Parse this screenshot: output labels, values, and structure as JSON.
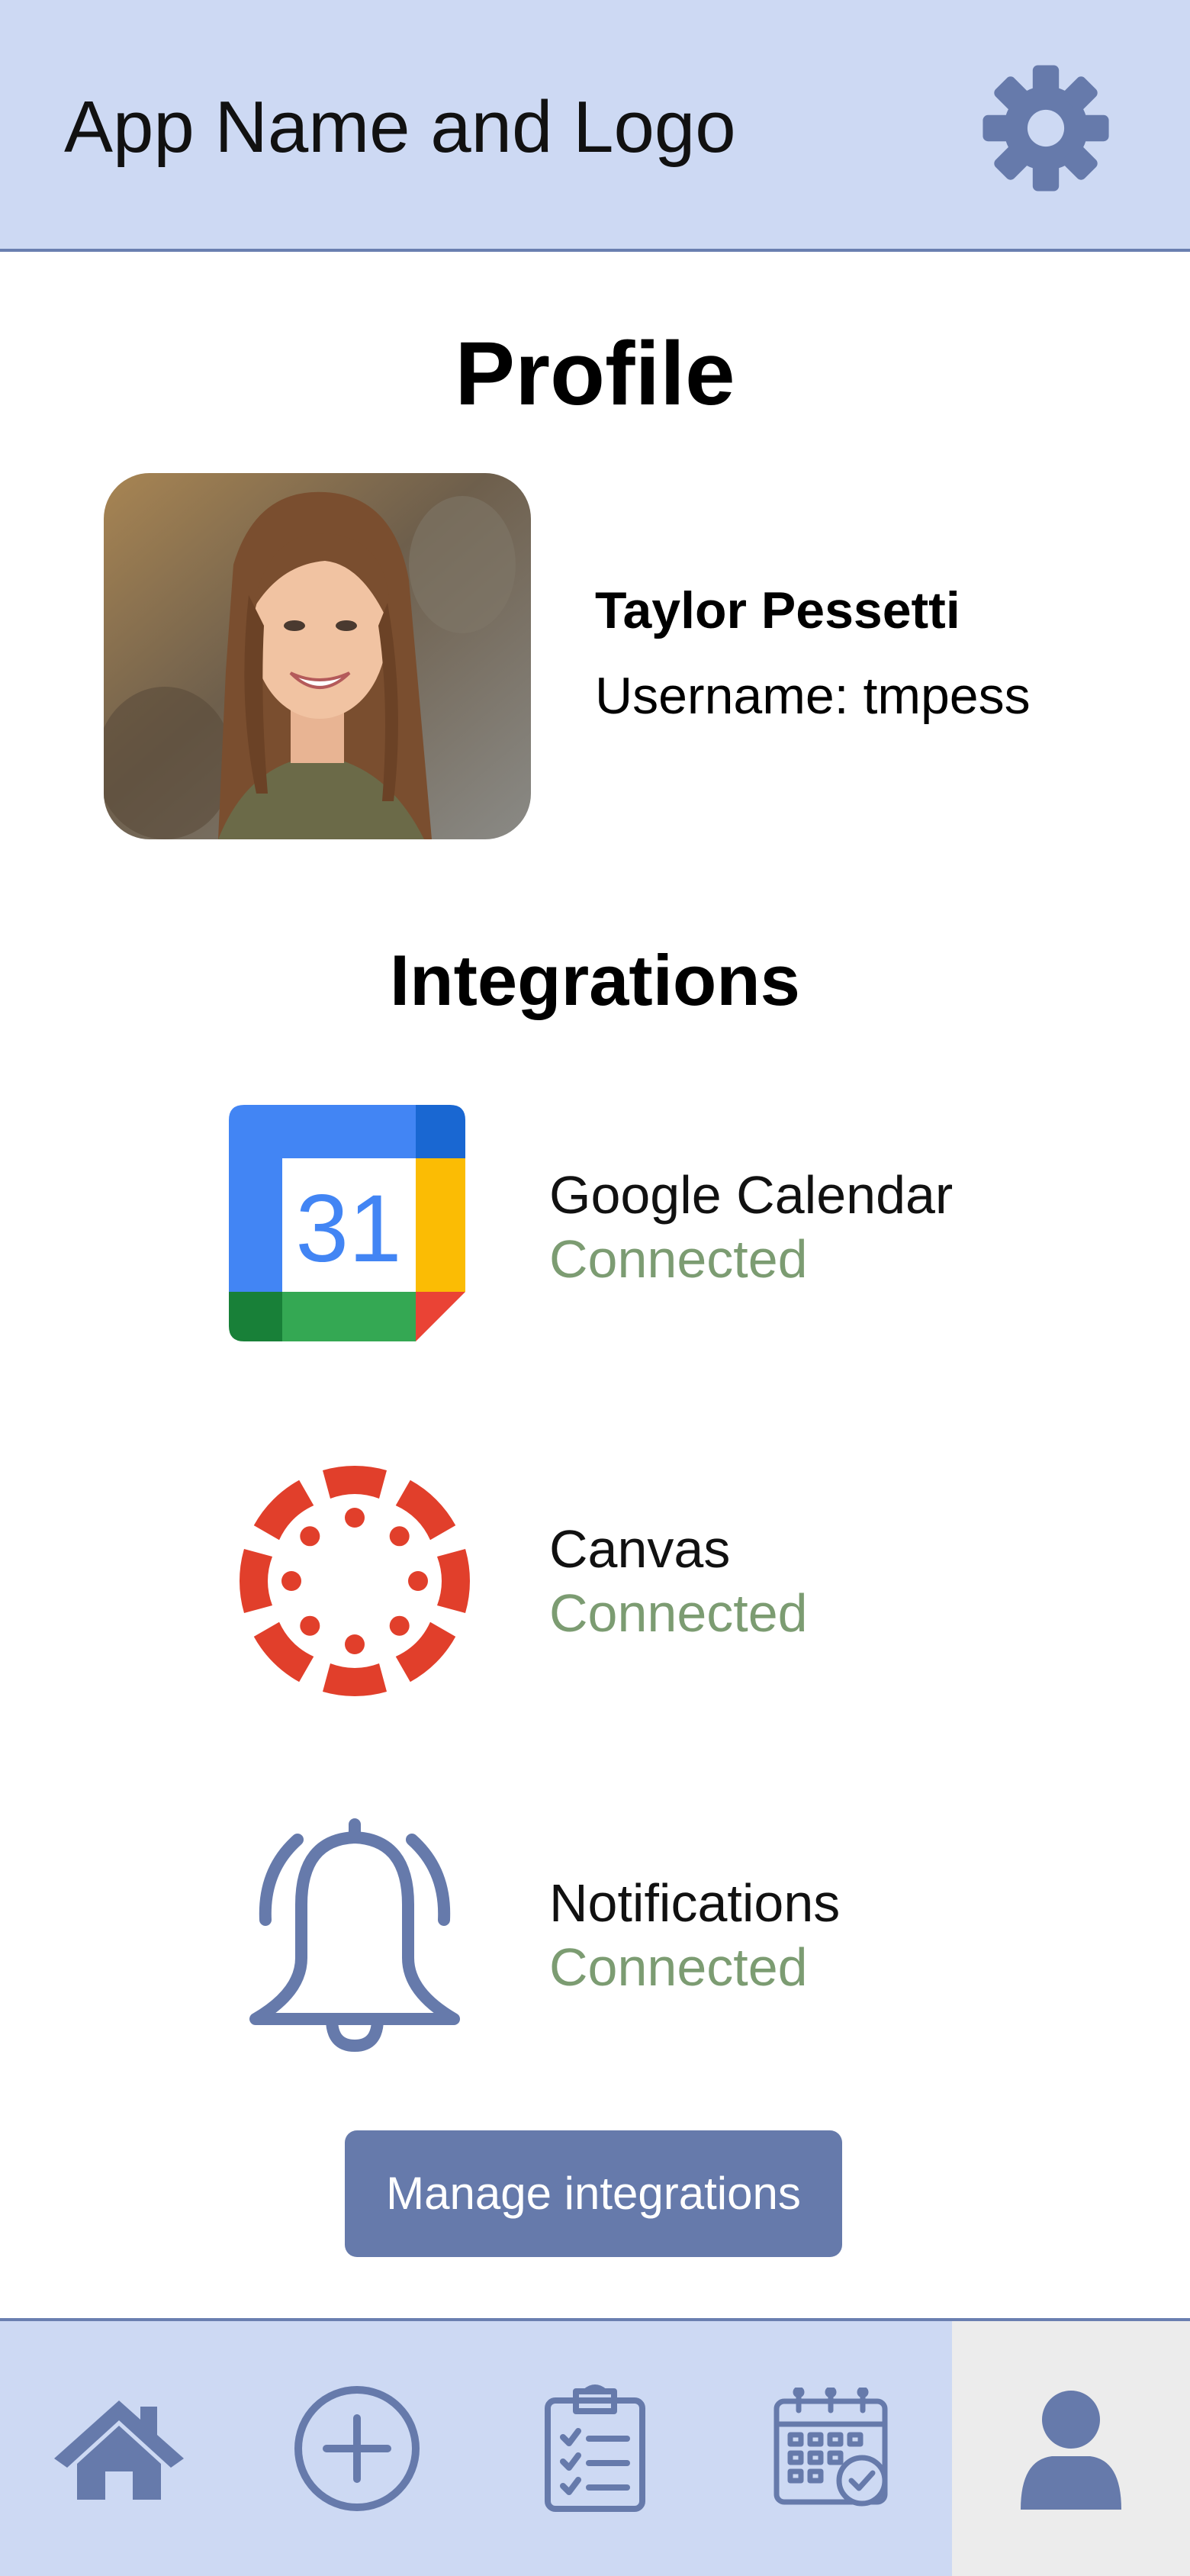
{
  "header": {
    "app_title": "App Name and Logo",
    "settings_icon": "gear-icon"
  },
  "profile": {
    "title": "Profile",
    "name": "Taylor Pessetti",
    "username": "Username: tmpess"
  },
  "integrations": {
    "title": "Integrations",
    "items": [
      {
        "name": "Google Calendar",
        "status": "Connected",
        "icon": "google-calendar-icon",
        "icon_text": "31"
      },
      {
        "name": "Canvas",
        "status": "Connected",
        "icon": "canvas-icon"
      },
      {
        "name": "Notifications",
        "status": "Connected",
        "icon": "bell-icon"
      }
    ],
    "manage_label": "Manage integrations"
  },
  "nav": {
    "items": [
      "home-icon",
      "add-circle-icon",
      "clipboard-checklist-icon",
      "calendar-check-icon",
      "user-icon"
    ],
    "active": "user-icon"
  },
  "colors": {
    "header_bg": "#cdd9f3",
    "accent": "#667aab",
    "status_connected": "#7c9c72",
    "active_tab_bg": "#ececec"
  }
}
